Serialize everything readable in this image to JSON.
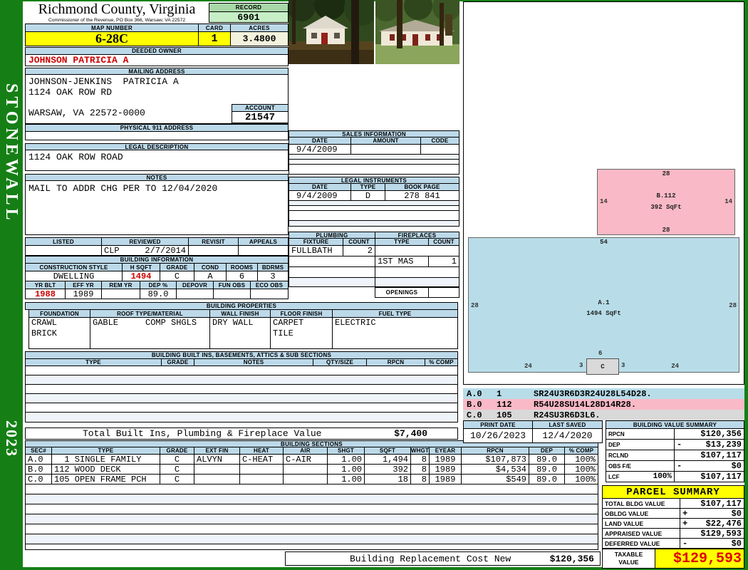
{
  "sidebar": {
    "district": "STONEWALL",
    "year": "2023"
  },
  "header": {
    "county": "Richmond County, Virginia",
    "commissioner": "Commissioner of the Revenue, PO Box 366, Warsaw, VA 22572",
    "record_label": "RECORD",
    "record": "6901",
    "map_number_label": "MAP NUMBER",
    "map_number": "6-28C",
    "card_label": "CARD",
    "card": "1",
    "acres_label": "ACRES",
    "acres": "3.4800"
  },
  "owner": {
    "deeded_owner_label": "DEEDED OWNER",
    "deeded_owner": "JOHNSON PATRICIA A",
    "mailing_address_label": "MAILING ADDRESS",
    "mailing_line1": "JOHNSON-JENKINS  PATRICIA A",
    "mailing_line2": "1124 OAK ROW RD",
    "mailing_line3": "WARSAW, VA 22572-0000",
    "account_label": "ACCOUNT",
    "account": "21547",
    "physical_911_label": "PHYSICAL 911 ADDRESS",
    "physical_911": "",
    "legal_description_label": "LEGAL DESCRIPTION",
    "legal_description": "1124 OAK ROW ROAD",
    "notes_label": "NOTES",
    "notes": "MAIL TO ADDR CHG PER TO 12/04/2020"
  },
  "review": {
    "headers": [
      "LISTED",
      "REVIEWED",
      "REVISIT",
      "APPEALS"
    ],
    "listed": "",
    "reviewed_by": "CLP",
    "reviewed_date": "2/7/2014",
    "revisit": "",
    "appeals": ""
  },
  "building_info": {
    "title": "BUILDING INFORMATION",
    "row1_headers": [
      "CONSTRUCTION STYLE",
      "H SQFT",
      "GRADE",
      "COND",
      "ROOMS",
      "BDRMS"
    ],
    "row1_values": [
      "DWELLING",
      "1494",
      "C",
      "A",
      "6",
      "3"
    ],
    "row2_headers": [
      "YR BLT",
      "EFF YR",
      "REM YR",
      "DEP %",
      "DEPOVR",
      "FUN OBS",
      "ECO OBS"
    ],
    "row2_values": [
      "1988",
      "1989",
      "",
      "89.0",
      "",
      "",
      ""
    ]
  },
  "building_properties": {
    "title": "BUILDING PROPERTIES",
    "headers": [
      "FOUNDATION",
      "ROOF TYPE/MATERIAL",
      "WALL FINISH",
      "FLOOR FINISH",
      "FUEL TYPE"
    ],
    "foundation": "CRAWL\nBRICK",
    "roof_type": "GABLE",
    "roof_material": "COMP SHGLS",
    "wall_finish": "DRY WALL",
    "floor_finish": "CARPET\nTILE",
    "fuel_type": "ELECTRIC"
  },
  "built_ins": {
    "title": "BUILDING BUILT INS, BASEMENTS, ATTICS & SUB SECTIONS",
    "headers": [
      "TYPE",
      "GRADE",
      "NOTES",
      "QTY/SIZE",
      "RPCN",
      "% COMP"
    ]
  },
  "totals": {
    "built_ins_label": "Total Built Ins, Plumbing & Fireplace Value",
    "built_ins_value": "$7,400",
    "replacement_label": "Building Replacement Cost New",
    "replacement_value": "$120,356"
  },
  "sales": {
    "title": "SALES INFORMATION",
    "headers": [
      "DATE",
      "AMOUNT",
      "CODE"
    ],
    "rows": [
      {
        "date": "9/4/2009",
        "amount": "",
        "code": ""
      }
    ]
  },
  "legal_instruments": {
    "title": "LEGAL INSTRUMENTS",
    "headers": [
      "DATE",
      "TYPE",
      "BOOK PAGE"
    ],
    "rows": [
      {
        "date": "9/4/2009",
        "type": "D",
        "bookpage": "278 841"
      }
    ]
  },
  "plumbing": {
    "title": "PLUMBING",
    "headers": [
      "FIXTURE",
      "COUNT"
    ],
    "rows": [
      {
        "fixture": "FULLBATH",
        "count": "2"
      }
    ]
  },
  "fireplaces": {
    "title": "FIREPLACES",
    "headers": [
      "TYPE",
      "COUNT"
    ],
    "row2_type": "1ST MAS",
    "row2_count": "1",
    "openings_label": "OPENINGS"
  },
  "sketch": {
    "b": {
      "name": "B.112",
      "sqft": "392 SqFt",
      "top": "28",
      "left": "14",
      "right": "14",
      "bottom": "28"
    },
    "a": {
      "name": "A.1",
      "sqft": "1494 SqFt",
      "top": "54",
      "left": "28",
      "right": "28",
      "bottom_left": "24",
      "bottom_right": "24"
    },
    "c": {
      "name": "C",
      "top": "6",
      "left": "3",
      "right": "3"
    },
    "codes": [
      {
        "sec": "A.0",
        "num": "1",
        "code": "SR24U3R6D3R24U28L54D28."
      },
      {
        "sec": "B.0",
        "num": "112",
        "code": "R54U28SU14L28D14R28."
      },
      {
        "sec": "C.0",
        "num": "105",
        "code": "R24SU3R6D3L6."
      }
    ]
  },
  "dates": {
    "print_label": "PRINT DATE",
    "print": "10/26/2023",
    "saved_label": "LAST SAVED",
    "saved": "12/4/2020"
  },
  "building_sections": {
    "title": "BUILDING SECTIONS",
    "headers": [
      "SEC#",
      "TYPE",
      "GRADE",
      "EXT FIN",
      "HEAT",
      "AIR",
      "SHGT",
      "SQFT",
      "WHGT",
      "EYEAR",
      "RPCN",
      "DEP",
      "% COMP"
    ],
    "rows": [
      {
        "sec": "A.0",
        "type": "  1 SINGLE FAMILY",
        "grade": "C",
        "extfin": "ALVYN",
        "heat": "C-HEAT",
        "air": "C-AIR",
        "shgt": "1.00",
        "sqft": "1,494",
        "whgt": "8",
        "eyear": "1989",
        "rpcn": "$107,873",
        "dep": "89.0",
        "comp": "100%"
      },
      {
        "sec": "B.0",
        "type": "112 WOOD DECK",
        "grade": "C",
        "extfin": "",
        "heat": "",
        "air": "",
        "shgt": "1.00",
        "sqft": "392",
        "whgt": "8",
        "eyear": "1989",
        "rpcn": "$4,534",
        "dep": "89.0",
        "comp": "100%"
      },
      {
        "sec": "C.0",
        "type": "105 OPEN FRAME PCH",
        "grade": "C",
        "extfin": "",
        "heat": "",
        "air": "",
        "shgt": "1.00",
        "sqft": "18",
        "whgt": "8",
        "eyear": "1989",
        "rpcn": "$549",
        "dep": "89.0",
        "comp": "100%"
      }
    ]
  },
  "value_summary": {
    "title": "BUILDING VALUE SUMMARY",
    "rows": [
      {
        "label": "RPCN",
        "extra": "",
        "op": "",
        "value": "$120,356"
      },
      {
        "label": "DEP",
        "extra": "",
        "op": "-",
        "value": "$13,239"
      },
      {
        "label": "RCLND",
        "extra": "",
        "op": "",
        "value": "$107,117"
      },
      {
        "label": "OBS F/E",
        "extra": "",
        "op": "-",
        "value": "$0"
      },
      {
        "label": "LCF",
        "extra": "100%",
        "op": "",
        "value": "$107,117"
      }
    ]
  },
  "parcel_summary": {
    "title": "PARCEL SUMMARY",
    "rows": [
      {
        "label": "TOTAL BLDG VALUE",
        "op": "",
        "value": "$107,117"
      },
      {
        "label": "OBLDG VALUE",
        "op": "+",
        "value": "$0"
      },
      {
        "label": "LAND VALUE",
        "op": "+",
        "value": "$22,476"
      },
      {
        "label": "APPRAISED VALUE",
        "op": "",
        "value": "$129,593"
      },
      {
        "label": "DEFERRED VALUE",
        "op": "-",
        "value": "$0"
      }
    ],
    "taxable_label_1": "TAXABLE",
    "taxable_label_2": "VALUE",
    "taxable_value": "$129,593"
  },
  "colors": {
    "sidebar_green": "#157f15",
    "header_bar_blue": "#bcd9e9",
    "highlight_yellow": "#ffff00",
    "record_green": "#c6efc6",
    "acres_ivory": "#f2f2dd",
    "owner_red": "#cc0000",
    "taxable_red": "#e00000",
    "sketch_blue": "#b8dde9",
    "sketch_pink": "#f9b9c6",
    "sketch_gray": "#d9d9d9"
  }
}
